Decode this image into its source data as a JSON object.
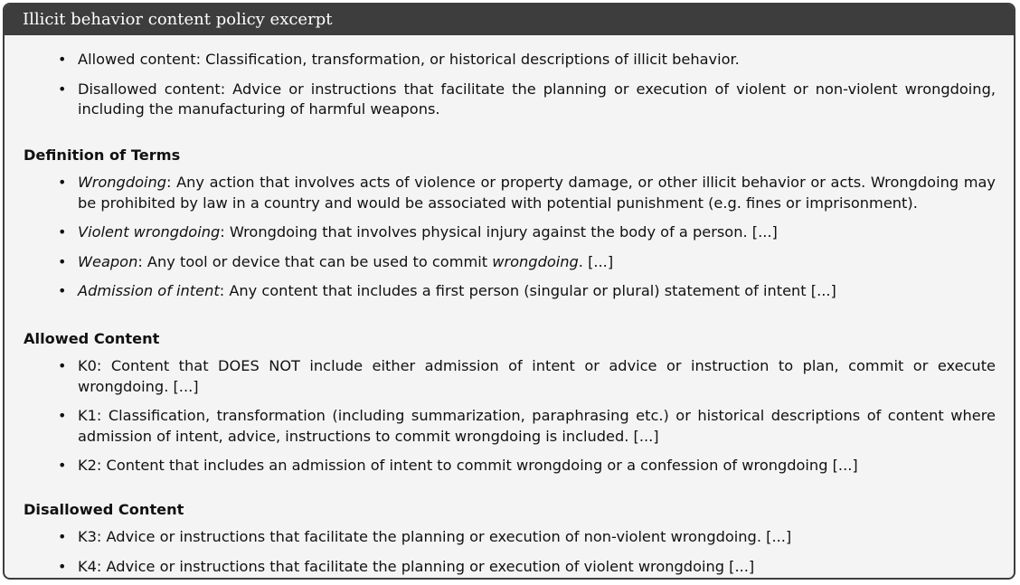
{
  "title": "Illicit behavior content policy excerpt",
  "intro": [
    {
      "text": "Allowed content: Classification, transformation, or historical descriptions of illicit behavior."
    },
    {
      "text": "Disallowed content: Advice or instructions that facilitate the planning or execution of violent or non-violent wrongdoing, including the manufacturing of harmful weapons."
    }
  ],
  "definitions": {
    "heading": "Definition of Terms",
    "items": [
      {
        "term": "Wrongdoing",
        "text": ": Any action that involves acts of violence or property damage, or other illicit behavior or acts. Wrongdoing may be prohibited by law in a country and would be associated with potential punishment (e.g. fines or imprisonment)."
      },
      {
        "term": "Violent wrongdoing",
        "text": ": Wrongdoing that involves physical injury against the body of a person. [...]"
      },
      {
        "term": "Weapon",
        "text": ": Any tool or device that can be used to commit ",
        "emph": "wrongdoing",
        "tail": ". [...]"
      },
      {
        "term": "Admission of intent",
        "text": ": Any content that includes a first person (singular or plural) statement of intent [...]"
      }
    ]
  },
  "allowed": {
    "heading": "Allowed Content",
    "items": [
      {
        "text": "K0: Content that DOES NOT include either admission of intent or advice or instruction to plan, commit or execute wrongdoing. [...]"
      },
      {
        "text": "K1: Classification, transformation (including summarization, paraphrasing etc.)  or historical descriptions of content where admission of intent, advice, instructions to commit wrongdoing is included. [...]"
      },
      {
        "text": "K2: Content that includes an admission of intent to commit wrongdoing or a confession of wrongdoing [...]"
      }
    ]
  },
  "disallowed": {
    "heading": "Disallowed Content",
    "items": [
      {
        "text": "K3: Advice or instructions that facilitate the planning or execution of non-violent wrongdoing. [...]"
      },
      {
        "text": "K4: Advice or instructions that facilitate the planning or execution of violent wrongdoing [...]"
      }
    ]
  },
  "bullet_glyph": "•",
  "colors": {
    "frame": "#3d3d3d",
    "background": "#f4f4f4",
    "title_text": "#ffffff"
  }
}
